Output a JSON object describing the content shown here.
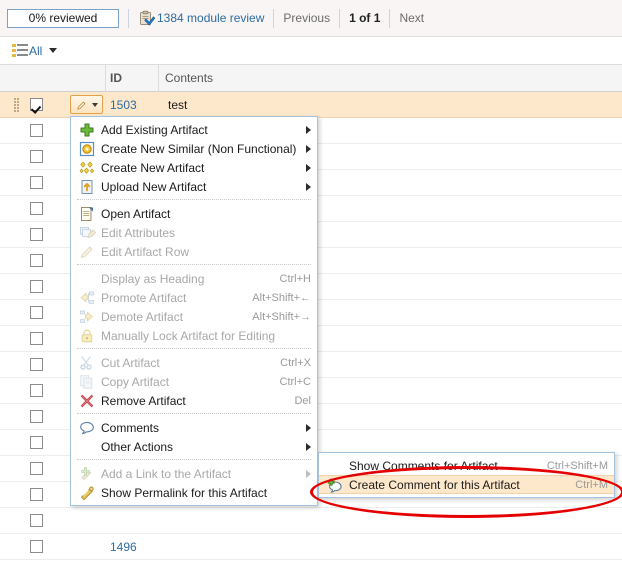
{
  "toolbar": {
    "review_button_label": "0% reviewed",
    "module_review_label": "1384 module review",
    "module_review_icon": "clipboard-check-icon",
    "previous_label": "Previous",
    "page_indicator": "1 of 1",
    "next_label": "Next"
  },
  "filterbar": {
    "filter_icon": "list-filter-icon",
    "filter_label": "All",
    "dropdown_icon": "chevron-down-icon"
  },
  "table": {
    "columns": [
      "",
      "",
      "ID",
      "Contents"
    ],
    "header_id": "ID",
    "header_contents": "Contents",
    "rows": [
      {
        "id": "1503",
        "contents": "test",
        "selected": true,
        "checked": true
      },
      {
        "id": "",
        "contents": "",
        "selected": false,
        "checked": false
      },
      {
        "id": "",
        "contents": "",
        "selected": false,
        "checked": false
      },
      {
        "id": "",
        "contents": "",
        "selected": false,
        "checked": false
      },
      {
        "id": "",
        "contents": "",
        "selected": false,
        "checked": false
      },
      {
        "id": "",
        "contents": "",
        "selected": false,
        "checked": false
      },
      {
        "id": "",
        "contents": "",
        "selected": false,
        "checked": false
      },
      {
        "id": "",
        "contents": "",
        "selected": false,
        "checked": false
      },
      {
        "id": "",
        "contents": "",
        "selected": false,
        "checked": false
      },
      {
        "id": "",
        "contents": "",
        "selected": false,
        "checked": false
      },
      {
        "id": "",
        "contents": "",
        "selected": false,
        "checked": false
      },
      {
        "id": "",
        "contents": "",
        "selected": false,
        "checked": false
      },
      {
        "id": "",
        "contents": "",
        "selected": false,
        "checked": false
      },
      {
        "id": "",
        "contents": "",
        "selected": false,
        "checked": false
      },
      {
        "id": "",
        "contents": "",
        "selected": false,
        "checked": false
      },
      {
        "id": "",
        "contents": "",
        "selected": false,
        "checked": false
      },
      {
        "id": "",
        "contents": "",
        "selected": false,
        "checked": false
      },
      {
        "id": "1496",
        "contents": "",
        "selected": false,
        "checked": false
      }
    ]
  },
  "context_menu": {
    "items": [
      {
        "label": "Add Existing Artifact",
        "icon": "green-plus-icon",
        "accel": "",
        "submenu": true,
        "disabled": false
      },
      {
        "label": "Create New Similar (Non Functional)",
        "icon": "similar-artifact-icon",
        "accel": "",
        "submenu": true,
        "disabled": false
      },
      {
        "label": "Create New Artifact",
        "icon": "new-artifact-icon",
        "accel": "",
        "submenu": true,
        "disabled": false
      },
      {
        "label": "Upload New Artifact",
        "icon": "upload-icon",
        "accel": "",
        "submenu": true,
        "disabled": false
      },
      {
        "separator": true
      },
      {
        "label": "Open Artifact",
        "icon": "document-open-icon",
        "accel": "",
        "submenu": false,
        "disabled": false
      },
      {
        "label": "Edit Attributes",
        "icon": "edit-attributes-icon",
        "accel": "",
        "submenu": false,
        "disabled": true
      },
      {
        "label": "Edit Artifact Row",
        "icon": "pencil-icon",
        "accel": "",
        "submenu": false,
        "disabled": true
      },
      {
        "separator": true
      },
      {
        "label": "Display as Heading",
        "icon": "",
        "accel": "Ctrl+H",
        "submenu": false,
        "disabled": true
      },
      {
        "label": "Promote Artifact",
        "icon": "promote-icon",
        "accel": "Alt+Shift+←",
        "submenu": false,
        "disabled": true
      },
      {
        "label": "Demote Artifact",
        "icon": "demote-icon",
        "accel": "Alt+Shift+→",
        "submenu": false,
        "disabled": true
      },
      {
        "label": "Manually Lock Artifact for Editing",
        "icon": "lock-icon",
        "accel": "",
        "submenu": false,
        "disabled": true
      },
      {
        "separator": true
      },
      {
        "label": "Cut Artifact",
        "icon": "scissors-icon",
        "accel": "Ctrl+X",
        "submenu": false,
        "disabled": true
      },
      {
        "label": "Copy Artifact",
        "icon": "copy-icon",
        "accel": "Ctrl+C",
        "submenu": false,
        "disabled": true
      },
      {
        "label": "Remove Artifact",
        "icon": "red-x-icon",
        "accel": "Del",
        "submenu": false,
        "disabled": false
      },
      {
        "separator": true
      },
      {
        "label": "Comments",
        "icon": "speech-balloon-icon",
        "accel": "",
        "submenu": true,
        "disabled": false
      },
      {
        "label": "Other Actions",
        "icon": "",
        "accel": "",
        "submenu": true,
        "disabled": false
      },
      {
        "separator": true
      },
      {
        "label": "Add a Link to the Artifact",
        "icon": "link-add-icon",
        "accel": "",
        "submenu": true,
        "disabled": true
      },
      {
        "label": "Show Permalink for this Artifact",
        "icon": "permalink-icon",
        "accel": "",
        "submenu": false,
        "disabled": false
      }
    ]
  },
  "submenu": {
    "items": [
      {
        "label": "Show Comments for Artifact",
        "icon": "",
        "accel": "Ctrl+Shift+M",
        "highlighted": false
      },
      {
        "label": "Create Comment for this Artifact",
        "icon": "comment-add-icon",
        "accel": "Ctrl+M",
        "highlighted": true
      }
    ]
  },
  "annotation": {
    "shape": "ellipse",
    "color": "#e50000",
    "target": "Create Comment for this Artifact"
  },
  "colors": {
    "toolbar_bg": "#faf5f5",
    "link": "#2d6ca2",
    "selected_row": "#fde8cc",
    "menu_border": "#a5c3de",
    "annotation_red": "#e50000"
  }
}
